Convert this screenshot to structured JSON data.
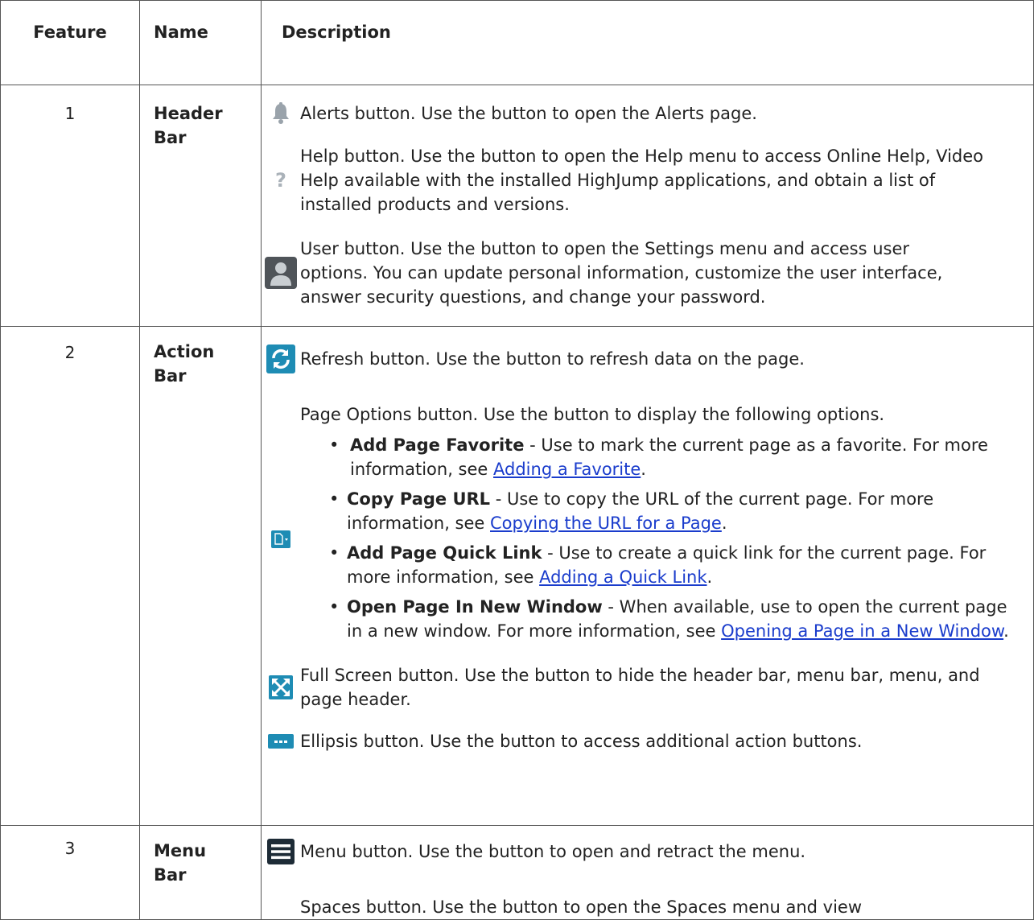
{
  "headers": [
    "Feature",
    "Name",
    "Description"
  ],
  "rows": [
    {
      "feature": "1",
      "name": "Header Bar",
      "items": [
        {
          "icon": "bell-icon",
          "text": "Alerts button. Use the button to open the Alerts page."
        },
        {
          "icon": "question-icon",
          "text": "Help button. Use the button to open the Help menu to access Online Help, Video Help available with the installed HighJump applications, and obtain a list of installed products and versions."
        },
        {
          "icon": "user-icon",
          "text": "User button. Use the button to open the Settings menu and access user options. You can update personal information, customize the user interface, answer security questions, and change your password."
        }
      ]
    },
    {
      "feature": "2",
      "name": "Action Bar",
      "refresh": {
        "icon": "refresh-icon",
        "text": "Refresh button. Use the button to refresh data on the page."
      },
      "page_options": {
        "icon": "page-options-icon",
        "intro": "Page Options button. Use the button to display the following options.",
        "options": [
          {
            "label": "Add Page Favorite",
            "text": " - Use to mark the current page as a favorite. For more information, see ",
            "link": "Adding a Favorite",
            "after": "."
          },
          {
            "label": "Copy Page URL",
            "text": " - Use to copy the URL of the current page. For more information, see ",
            "link": "Copying the URL for a Page",
            "after": "."
          },
          {
            "label": "Add Page Quick Link",
            "text": " - Use to create a quick link for the current page. For more information, see ",
            "link": "Adding a Quick Link",
            "after": "."
          },
          {
            "label": "Open Page In New Window",
            "text": " - When available, use to open the current page in a new window. For more information, see ",
            "link": "Opening a Page in a New Window",
            "after": "."
          }
        ]
      },
      "fullscreen": {
        "icon": "full-screen-icon",
        "text": "Full Screen button. Use the button to hide the header bar, menu bar, menu, and page header."
      },
      "ellipsis": {
        "icon": "ellipsis-icon",
        "text": "Ellipsis button. Use the button to access additional action buttons."
      }
    },
    {
      "feature": "3",
      "name": "Menu Bar",
      "items": [
        {
          "icon": "menu-icon",
          "text": "Menu button. Use the button to open and retract the menu."
        },
        {
          "icon": "",
          "text": "Spaces button. Use the button to open the Spaces menu and view"
        }
      ]
    }
  ],
  "colors": {
    "accent": "#1e8cb4",
    "dark": "#1d2b36",
    "link": "#1a3ccc"
  }
}
